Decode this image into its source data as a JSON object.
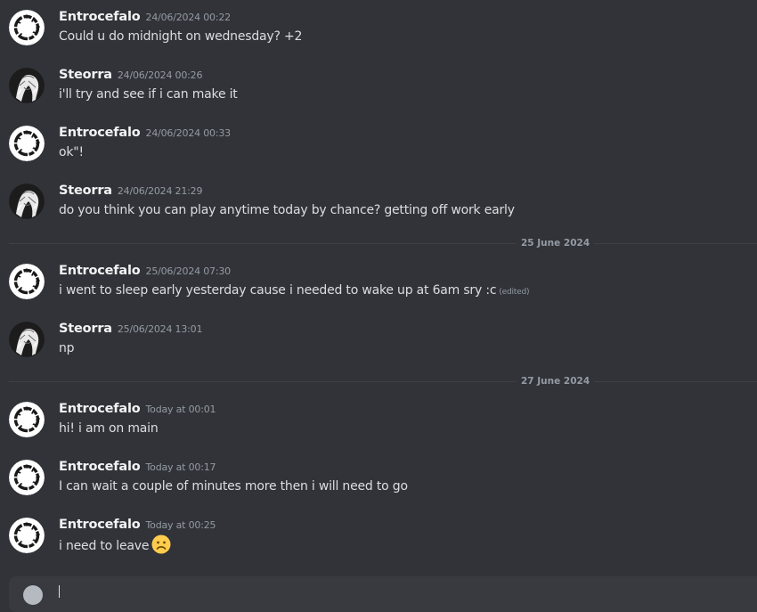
{
  "messages": [
    {
      "author": "Entrocefalo",
      "timestamp": "24/06/2024 00:22",
      "text": "Could u do midnight on  wednesday? +2",
      "avatar": "ring"
    },
    {
      "author": "Steorra",
      "timestamp": "24/06/2024 00:26",
      "text": "i'll try and see if i can make it",
      "avatar": "anime"
    },
    {
      "author": "Entrocefalo",
      "timestamp": "24/06/2024 00:33",
      "text": "ok\"!",
      "avatar": "ring"
    },
    {
      "author": "Steorra",
      "timestamp": "24/06/2024 21:29",
      "text": "do you think you can play anytime today by chance? getting off work early",
      "avatar": "anime"
    },
    {
      "author": "Entrocefalo",
      "timestamp": "25/06/2024 07:30",
      "text": "i went to sleep early yesterday cause i needed to wake up at 6am sry :c",
      "edited": "(edited)",
      "avatar": "ring"
    },
    {
      "author": "Steorra",
      "timestamp": "25/06/2024 13:01",
      "text": "np",
      "avatar": "anime"
    },
    {
      "author": "Entrocefalo",
      "timestamp": "Today at 00:01",
      "text": "hi! i am on main",
      "avatar": "ring"
    },
    {
      "author": "Entrocefalo",
      "timestamp": "Today at 00:17",
      "text": "I can wait a couple of minutes more then i will need to go",
      "avatar": "ring"
    },
    {
      "author": "Entrocefalo",
      "timestamp": "Today at 00:25",
      "text": "i need to leave",
      "emoji": "frowning-face-emoji",
      "avatar": "ring"
    }
  ],
  "dividers": [
    "25 June 2024",
    "27 June 2024"
  ],
  "icons": {
    "composer_add": "plus-circle-icon"
  },
  "colors": {
    "background": "#313338",
    "username": "#f2f3f5",
    "message_text": "#dbdee1",
    "muted": "#949ba4",
    "divider_line": "#3f4147",
    "composer": "#383a40"
  }
}
